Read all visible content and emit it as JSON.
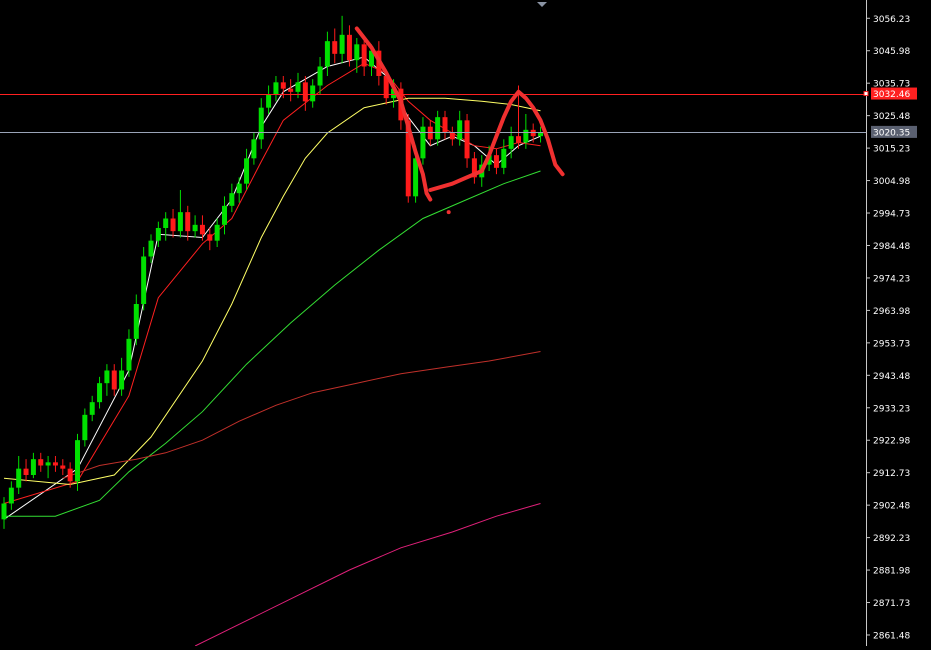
{
  "chart_data": {
    "type": "candlestick",
    "title": "",
    "xlabel": "",
    "ylabel": "",
    "ylim": [
      2858,
      3062
    ],
    "grid": false,
    "background_color": "#000000",
    "up_color": "#00e000",
    "down_color": "#ff1a1a",
    "y_ticks": [
      "3056.23",
      "3045.98",
      "3035.73",
      "3025.48",
      "3015.23",
      "3004.98",
      "2994.73",
      "2984.48",
      "2974.23",
      "2963.98",
      "2953.73",
      "2943.48",
      "2933.23",
      "2922.98",
      "2912.73",
      "2902.48",
      "2892.23",
      "2881.98",
      "2871.73",
      "2861.48"
    ],
    "price_lines": [
      {
        "value": 3032.46,
        "label": "3032.46",
        "color": "#ff2020",
        "label_bg": "#ff2020",
        "label_color": "#ffffff"
      },
      {
        "value": 3020.35,
        "label": "3020.35",
        "color": "#9aa4b8",
        "label_bg": "#5a6070",
        "label_color": "#ffffff"
      }
    ],
    "candles": [
      [
        2898,
        2903,
        2895,
        2905
      ],
      [
        2903,
        2908,
        2901,
        2910
      ],
      [
        2908,
        2914,
        2906,
        2918
      ],
      [
        2914,
        2912,
        2910,
        2917
      ],
      [
        2912,
        2917,
        2911,
        2919
      ],
      [
        2917,
        2915,
        2913,
        2919
      ],
      [
        2915,
        2916,
        2911,
        2918
      ],
      [
        2916,
        2915,
        2913,
        2918
      ],
      [
        2915,
        2914,
        2912,
        2917
      ],
      [
        2914,
        2910,
        2908,
        2916
      ],
      [
        2910,
        2923,
        2907,
        2925
      ],
      [
        2923,
        2931,
        2921,
        2933
      ],
      [
        2931,
        2935,
        2929,
        2937
      ],
      [
        2935,
        2941,
        2933,
        2943
      ],
      [
        2941,
        2945,
        2937,
        2947
      ],
      [
        2945,
        2939,
        2937,
        2947
      ],
      [
        2939,
        2945,
        2937,
        2949
      ],
      [
        2945,
        2955,
        2943,
        2958
      ],
      [
        2955,
        2966,
        2953,
        2969
      ],
      [
        2966,
        2981,
        2964,
        2984
      ],
      [
        2981,
        2986,
        2979,
        2988
      ],
      [
        2986,
        2990,
        2984,
        2992
      ],
      [
        2990,
        2993,
        2986,
        2995
      ],
      [
        2993,
        2989,
        2987,
        2996
      ],
      [
        2989,
        2995,
        2987,
        3002
      ],
      [
        2995,
        2989,
        2986,
        2997
      ],
      [
        2989,
        2991,
        2987,
        2994
      ],
      [
        2991,
        2988,
        2986,
        2994
      ],
      [
        2988,
        2986,
        2983,
        2990
      ],
      [
        2986,
        2991,
        2984,
        2993
      ],
      [
        2991,
        2997,
        2988,
        3000
      ],
      [
        2997,
        3001,
        2995,
        3004
      ],
      [
        3001,
        3004,
        2998,
        3006
      ],
      [
        3004,
        3012,
        3002,
        3015
      ],
      [
        3012,
        3018,
        3010,
        3020
      ],
      [
        3018,
        3028,
        3015,
        3031
      ],
      [
        3028,
        3032,
        3026,
        3035
      ],
      [
        3032,
        3036,
        3030,
        3038
      ],
      [
        3036,
        3034,
        3031,
        3038
      ],
      [
        3034,
        3033,
        3030,
        3037
      ],
      [
        3033,
        3036,
        3031,
        3039
      ],
      [
        3036,
        3030,
        3027,
        3038
      ],
      [
        3030,
        3035,
        3028,
        3037
      ],
      [
        3035,
        3041,
        3032,
        3044
      ],
      [
        3041,
        3049,
        3038,
        3052
      ],
      [
        3049,
        3045,
        3042,
        3053
      ],
      [
        3045,
        3051,
        3042,
        3057
      ],
      [
        3051,
        3043,
        3041,
        3054
      ],
      [
        3043,
        3048,
        3039,
        3050
      ],
      [
        3048,
        3041,
        3038,
        3050
      ],
      [
        3041,
        3046,
        3038,
        3048
      ],
      [
        3046,
        3038,
        3035,
        3049
      ],
      [
        3038,
        3031,
        3029,
        3040
      ],
      [
        3031,
        3034,
        3028,
        3037
      ],
      [
        3034,
        3024,
        3021,
        3036
      ],
      [
        3024,
        3000,
        2998,
        3026
      ],
      [
        3000,
        3012,
        2998,
        3016
      ],
      [
        3012,
        3022,
        3010,
        3025
      ],
      [
        3022,
        3018,
        3016,
        3024
      ],
      [
        3018,
        3025,
        3016,
        3027
      ],
      [
        3025,
        3020,
        3018,
        3027
      ],
      [
        3020,
        3018,
        3016,
        3022
      ],
      [
        3018,
        3024,
        3016,
        3027
      ],
      [
        3024,
        3012,
        3009,
        3026
      ],
      [
        3012,
        3006,
        3004,
        3014
      ],
      [
        3006,
        3010,
        3003,
        3013
      ],
      [
        3010,
        3013,
        3008,
        3016
      ],
      [
        3013,
        3009,
        3007,
        3015
      ],
      [
        3009,
        3015,
        3007,
        3018
      ],
      [
        3015,
        3019,
        3012,
        3022
      ],
      [
        3019,
        3017,
        3015,
        3035
      ],
      [
        3017,
        3021,
        3015,
        3026
      ],
      [
        3021,
        3019,
        3017,
        3023
      ],
      [
        3019,
        3020,
        3017,
        3022
      ]
    ],
    "moving_averages": [
      {
        "color": "#ffffff",
        "width": 1,
        "points": [
          [
            0,
            2898
          ],
          [
            10,
            2914
          ],
          [
            17,
            2945
          ],
          [
            21,
            2988
          ],
          [
            27,
            2987
          ],
          [
            31,
            2999
          ],
          [
            35,
            3022
          ],
          [
            38,
            3033
          ],
          [
            44,
            3041
          ],
          [
            49,
            3044
          ],
          [
            52,
            3038
          ],
          [
            55,
            3025
          ],
          [
            58,
            3016
          ],
          [
            61,
            3019
          ],
          [
            64,
            3016
          ],
          [
            67,
            3010
          ],
          [
            70,
            3016
          ],
          [
            73,
            3019
          ]
        ]
      },
      {
        "color": "#ff2020",
        "width": 1,
        "points": [
          [
            0,
            2903
          ],
          [
            10,
            2910
          ],
          [
            17,
            2937
          ],
          [
            21,
            2968
          ],
          [
            27,
            2985
          ],
          [
            31,
            2993
          ],
          [
            35,
            3011
          ],
          [
            38,
            3024
          ],
          [
            44,
            3035
          ],
          [
            49,
            3042
          ],
          [
            52,
            3039
          ],
          [
            55,
            3030
          ],
          [
            58,
            3024
          ],
          [
            61,
            3020
          ],
          [
            64,
            3016
          ],
          [
            67,
            3015
          ],
          [
            70,
            3017
          ],
          [
            73,
            3016
          ]
        ]
      },
      {
        "color": "#ffff66",
        "width": 1,
        "points": [
          [
            0,
            2911
          ],
          [
            9,
            2909
          ],
          [
            15,
            2912
          ],
          [
            20,
            2924
          ],
          [
            27,
            2948
          ],
          [
            31,
            2966
          ],
          [
            35,
            2987
          ],
          [
            38,
            3000
          ],
          [
            41,
            3012
          ],
          [
            44,
            3020
          ],
          [
            49,
            3028
          ],
          [
            55,
            3031
          ],
          [
            60,
            3031
          ],
          [
            65,
            3030
          ],
          [
            69,
            3029
          ],
          [
            73,
            3027
          ]
        ]
      },
      {
        "color": "#33dd33",
        "width": 1,
        "points": [
          [
            0,
            2899
          ],
          [
            7,
            2899
          ],
          [
            13,
            2904
          ],
          [
            17,
            2913
          ],
          [
            22,
            2922
          ],
          [
            27,
            2932
          ],
          [
            33,
            2947
          ],
          [
            39,
            2960
          ],
          [
            45,
            2972
          ],
          [
            51,
            2983
          ],
          [
            57,
            2993
          ],
          [
            63,
            2999
          ],
          [
            68,
            3004
          ],
          [
            73,
            3008
          ]
        ]
      },
      {
        "color": "#c0302a",
        "width": 1,
        "points": [
          [
            8,
            2911
          ],
          [
            13,
            2915
          ],
          [
            18,
            2917
          ],
          [
            22,
            2919
          ],
          [
            27,
            2923
          ],
          [
            32,
            2929
          ],
          [
            37,
            2934
          ],
          [
            42,
            2938
          ],
          [
            48,
            2941
          ],
          [
            54,
            2944
          ],
          [
            60,
            2946
          ],
          [
            66,
            2948
          ],
          [
            73,
            2951
          ]
        ]
      },
      {
        "color": "#e0207a",
        "width": 1,
        "points": [
          [
            26,
            2858
          ],
          [
            33,
            2866
          ],
          [
            40,
            2874
          ],
          [
            47,
            2882
          ],
          [
            54,
            2889
          ],
          [
            61,
            2894
          ],
          [
            67,
            2899
          ],
          [
            73,
            2903
          ]
        ]
      }
    ],
    "annotations": [
      {
        "type": "freehand",
        "color": "#f03030",
        "width": 4,
        "points": [
          [
            48,
            3053
          ],
          [
            50,
            3047
          ],
          [
            52,
            3039
          ],
          [
            54,
            3030
          ],
          [
            55,
            3022
          ],
          [
            56,
            3014
          ],
          [
            57,
            3007
          ],
          [
            57.5,
            3001
          ],
          [
            58,
            2999
          ]
        ]
      },
      {
        "type": "freehand",
        "color": "#f03030",
        "width": 4,
        "points": [
          [
            58,
            3002
          ],
          [
            61,
            3004
          ],
          [
            63,
            3006
          ],
          [
            65,
            3008
          ],
          [
            66,
            3013
          ],
          [
            67,
            3019
          ],
          [
            68,
            3025
          ],
          [
            69,
            3030
          ],
          [
            70,
            3033
          ],
          [
            71,
            3031
          ],
          [
            72,
            3028
          ],
          [
            73,
            3024
          ],
          [
            74,
            3018
          ],
          [
            75,
            3010
          ],
          [
            76,
            3007
          ]
        ]
      },
      {
        "type": "dot",
        "color": "#f03030",
        "points": [
          [
            60.5,
            2995
          ]
        ]
      }
    ]
  },
  "top_marker_icon": "triangle-down-icon"
}
